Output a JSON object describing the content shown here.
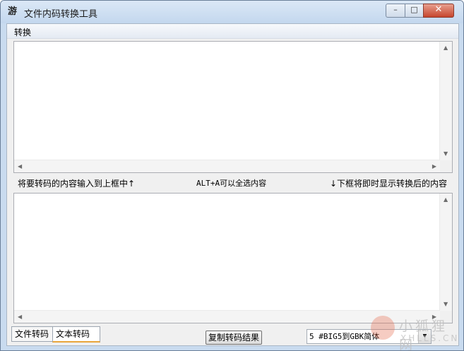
{
  "window": {
    "title": "文件内码转换工具",
    "icon": "app-logo-icon",
    "controls": {
      "minimize": "minimize-icon",
      "maximize": "maximize-icon",
      "close": "close-icon"
    }
  },
  "menu": {
    "items": [
      {
        "label": "转换"
      }
    ]
  },
  "editor": {
    "top_text": "",
    "bottom_text": ""
  },
  "info": {
    "left": "将要转码的内容输入到上框中↑",
    "middle": "ALT+A可以全选内容",
    "right": "↓下框将即时显示转换后的内容"
  },
  "tabs": [
    {
      "label": "文件转码",
      "selected": false
    },
    {
      "label": "文本转码",
      "selected": true
    }
  ],
  "actions": {
    "copy_label": "复制转码结果"
  },
  "conversion": {
    "selected": "5 #BIG5到GBK简体"
  },
  "watermark": {
    "main": "小狐狸网",
    "sub": "XHLLS.CN"
  }
}
